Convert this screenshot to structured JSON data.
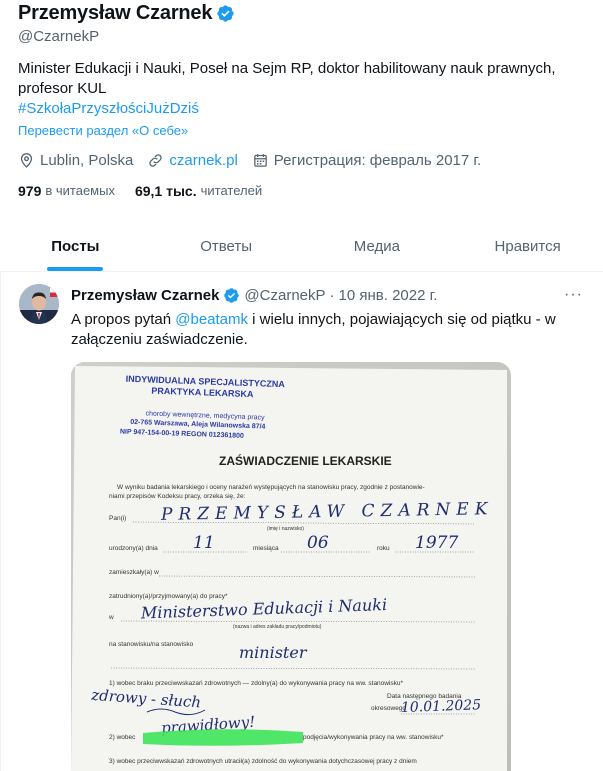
{
  "profile": {
    "name": "Przemysław Czarnek",
    "handle": "@CzarnekP",
    "bio": "Minister Edukacji i Nauki, Poseł na Sejm RP, doktor habilitowany nauk prawnych, profesor KUL",
    "hashtag": "#SzkołaPrzyszłościJużDziś",
    "translate": "Перевести раздел «О себе»",
    "location": "Lublin, Polska",
    "website": "czarnek.pl",
    "joined": "Регистрация: февраль 2017 г.",
    "following_count": "979",
    "following_label": "в читаемых",
    "followers_count": "69,1 тыс.",
    "followers_label": "читателей"
  },
  "tabs": [
    "Посты",
    "Ответы",
    "Медиа",
    "Нравится"
  ],
  "tweet": {
    "name": "Przemysław Czarnek",
    "handle": "@CzarnekP",
    "sep": "·",
    "date": "10 янв. 2022 г.",
    "more": "···",
    "text_before": "A propos pytań ",
    "mention": "@beatamk",
    "text_after": " i wielu innych, pojawiających się od piątku - w załączeniu zaświadczenie."
  },
  "document": {
    "stamp_line1": "INDYWIDUALNA SPECJALISTYCZNA",
    "stamp_line2": "PRAKTYKA LEKARSKA",
    "stamp_line3": "choroby wewnętrzne, medycyna pracy",
    "stamp_line4": "02-765 Warszawa, Aleja Wilanowska 87/4",
    "stamp_line5": "NIP 947-154-00-19    REGON 012361800",
    "title": "ZAŚWIADCZENIE LEKARSKIE",
    "intro": "W wyniku badania lekarskiego i oceny narażeń występujących na stanowisku pracy, zgodnie z postanowie-",
    "intro2": "niami przepisów Kodeksu pracy, orzeka się, że:",
    "pan_label": "Pan(i)",
    "pan_value": "PRZEMYSŁAW CZARNEK",
    "pan_caption": "(imię i nazwisko)",
    "born_label": "urodzony(a) dnia",
    "day": "11",
    "month_label": "miesiąca",
    "month": "06",
    "year_label": "roku",
    "year": "1977",
    "address_label": "zamieszkały(a) w",
    "employed_label": "zatrudniony(a)/przyjmowany(a) do pracy*",
    "w_label": "w",
    "employer": "Ministerstwo Edukacji i Nauki",
    "employer_caption": "(nazwa i adres zakładu pracy/podmiotu)",
    "position_label": "na stanowisku/na stanowisko",
    "position": "minister",
    "point1": "1) wobec braku przeciwwskazań zdrowotnych — zdolny(a) do wykonywania pracy na ww. stanowisku*",
    "handwritten1": "zdrowy - słuch",
    "handwritten2": "prawidłowy!",
    "next_exam_label": "Data następnego badania",
    "next_exam_label2": "okresowego",
    "next_exam": "10.01.2025",
    "point2": "2) wobec",
    "point2_end": "podjęcia/wykonywania pracy na ww. stanowisku*",
    "point3": "3) wobec przeciwwskazań zdrowotnych utracił(a) zdolność do wykonywania dotychczasowej pracy z dniem"
  },
  "colors": {
    "accent": "#1d9bf0",
    "text": "#0f1419",
    "muted": "#536471",
    "highlight": "#3ee45a"
  }
}
